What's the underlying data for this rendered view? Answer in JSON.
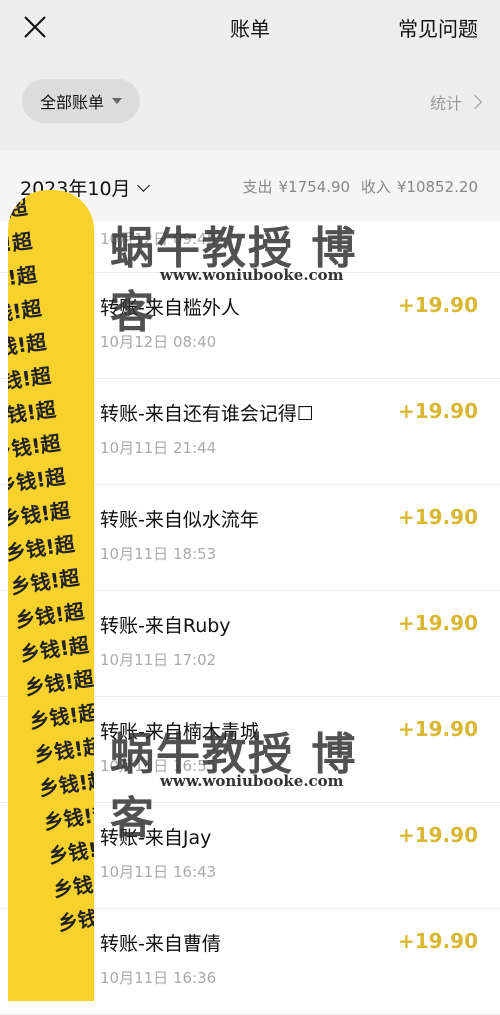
{
  "header": {
    "title": "账单",
    "faq_label": "常见问题",
    "filter_label": "全部账单",
    "stats_label": "统计"
  },
  "month_bar": {
    "month_label": "2023年10月",
    "expense_label": "支出",
    "expense_value": "¥1754.90",
    "income_label": "收入",
    "income_value": "¥10852.20"
  },
  "transactions": [
    {
      "name": "",
      "time": "10月12日 09:45",
      "amount": ""
    },
    {
      "name": "转账-来自槛外人",
      "time": "10月12日 08:40",
      "amount": "+19.90"
    },
    {
      "name": "转账-来自还有谁会记得☐",
      "time": "10月11日 21:44",
      "amount": "+19.90"
    },
    {
      "name": "转账-来自似水流年",
      "time": "10月11日 18:53",
      "amount": "+19.90"
    },
    {
      "name": "转账-来自Ruby",
      "time": "10月11日 17:02",
      "amount": "+19.90"
    },
    {
      "name": "转账-来自楠木青城",
      "time": "10月11日 16:55",
      "amount": "+19.90"
    },
    {
      "name": "转账-来自Jay",
      "time": "10月11日 16:43",
      "amount": "+19.90"
    },
    {
      "name": "转账-来自曹倩",
      "time": "10月11日 16:36",
      "amount": "+19.90"
    }
  ],
  "sticker": {
    "text": "乡钱!超乡钱!超乡钱!超乡钱!超乡钱!超乡钱!超乡钱!超乡钱!超乡钱!超乡钱!超乡钱!超乡钱!超乡钱!超乡钱!超乡钱!超乡钱!超乡钱!超乡钱!超乡钱!超乡钱!超乡钱!超乡钱!"
  },
  "watermark": {
    "main": "蜗牛教授 博客",
    "sub": "www.woniubooke.com"
  },
  "colors": {
    "amount": "#d9b733",
    "header_bg": "#ededed",
    "sticker_yellow": "#f7d22d"
  }
}
